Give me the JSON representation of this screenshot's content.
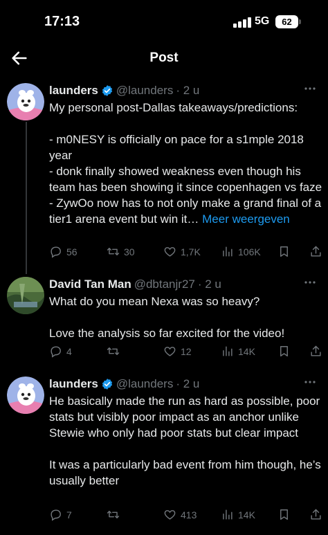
{
  "status_bar": {
    "time": "17:13",
    "network": "5G",
    "battery": "62"
  },
  "header": {
    "title": "Post"
  },
  "posts": [
    {
      "name": "launders",
      "handle": "@launders",
      "time": "· 2 u",
      "verified": true,
      "lines": [
        "My personal post-Dallas takeaways/predictions:",
        "- m0NESY is officially on pace for a s1mple 2018 year\n- donk finally showed weakness even though his team has been showing it since copenhagen vs faze\n- ZywOo now has to not only make a grand final of a tier1 arena event but win it…"
      ],
      "show_more": "Meer weergeven",
      "replies": "56",
      "reposts": "30",
      "likes": "1,7K",
      "views": "106K"
    },
    {
      "name": "David Tan Man",
      "handle": "@dbtanjr27",
      "time": "· 2 u",
      "verified": false,
      "lines": [
        "What do you mean Nexa was so heavy?",
        "Love the analysis so far excited for the video!"
      ],
      "replies": "4",
      "reposts": "",
      "likes": "12",
      "views": "14K"
    },
    {
      "name": "launders",
      "handle": "@launders",
      "time": "· 2 u",
      "verified": true,
      "lines": [
        "He basically made the run as hard as possible, poor stats but visibly poor impact as an anchor unlike Stewie who only had poor stats but clear impact",
        "It was a particularly bad event from him though, he’s usually better"
      ],
      "replies": "7",
      "reposts": "",
      "likes": "413",
      "views": "14K"
    }
  ],
  "colors": {
    "background": "#000000",
    "text": "#e7e9ea",
    "muted": "#71767b",
    "link": "#1d9bf0",
    "verified": "#1d9bf0"
  },
  "icons": [
    "back-arrow-icon",
    "verified-badge-icon",
    "more-icon",
    "reply-icon",
    "repost-icon",
    "like-icon",
    "views-icon",
    "bookmark-icon",
    "share-icon"
  ]
}
